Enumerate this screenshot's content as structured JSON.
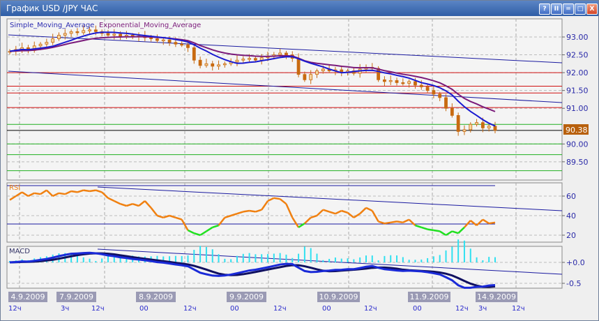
{
  "window": {
    "title": "График USD /JPY  ЧАС",
    "buttons": [
      "?",
      "II",
      "=",
      "□",
      "X"
    ]
  },
  "price_panel": {
    "legend_sma": "Simple_Moving_Average",
    "legend_ema": "Exponential_Moving_Average",
    "axis_labels": [
      "93.00",
      "92.50",
      "92.00",
      "91.50",
      "91.00",
      "90.00",
      "89.50"
    ],
    "axis_values": [
      93.0,
      92.5,
      92.0,
      91.5,
      91.0,
      90.0,
      89.5
    ],
    "current_price": "90.38",
    "current_value": 90.38,
    "red_levels": [
      92.0,
      91.62,
      91.43,
      91.02
    ],
    "green_levels": [
      90.55,
      90.0,
      89.7,
      89.25
    ],
    "closes": [
      92.6,
      92.65,
      92.7,
      92.62,
      92.75,
      92.8,
      92.85,
      92.95,
      93.05,
      93.1,
      93.15,
      93.12,
      93.18,
      93.2,
      93.15,
      93.1,
      93.05,
      93.08,
      93.02,
      93.05,
      93.0,
      93.03,
      92.98,
      92.95,
      92.9,
      92.92,
      92.85,
      92.8,
      92.78,
      92.7,
      92.35,
      92.2,
      92.25,
      92.18,
      92.22,
      92.25,
      92.3,
      92.35,
      92.38,
      92.4,
      92.35,
      92.42,
      92.45,
      92.5,
      92.55,
      92.5,
      92.4,
      91.95,
      91.8,
      91.95,
      92.05,
      92.1,
      92.05,
      92.08,
      92.0,
      92.05,
      91.98,
      92.1,
      92.15,
      92.12,
      91.8,
      91.75,
      91.78,
      91.72,
      91.7,
      91.75,
      91.65,
      91.6,
      91.5,
      91.4,
      91.3,
      91.0,
      90.8,
      90.35,
      90.4,
      90.55,
      90.6,
      90.45,
      90.5,
      90.38
    ],
    "colors": {
      "candle": "#c86a10",
      "sma": "#1a1ad0",
      "ema": "#7a1a7a",
      "red": "#d01010",
      "green": "#20b020",
      "trend": "#1a1aa0"
    }
  },
  "rsi_panel": {
    "label": "RSI",
    "axis_labels": [
      "60",
      "40",
      "20"
    ],
    "axis_values": [
      60,
      40,
      20
    ],
    "level": 31,
    "values": [
      56,
      60,
      64,
      60,
      63,
      62,
      66,
      60,
      63,
      62,
      65,
      64,
      66,
      65,
      66,
      64,
      58,
      55,
      52,
      50,
      52,
      50,
      55,
      48,
      40,
      38,
      40,
      38,
      36,
      25,
      22,
      20,
      24,
      28,
      30,
      38,
      40,
      42,
      44,
      45,
      44,
      46,
      55,
      58,
      57,
      52,
      38,
      28,
      32,
      38,
      40,
      46,
      44,
      42,
      45,
      43,
      38,
      42,
      48,
      45,
      34,
      32,
      33,
      34,
      33,
      36,
      30,
      28,
      26,
      25,
      24,
      20,
      24,
      22,
      28,
      35,
      30,
      36,
      32,
      33
    ],
    "colors": {
      "line": "#f08010",
      "low": "#20e020"
    }
  },
  "macd_panel": {
    "label": "MACD",
    "axis_labels": [
      "+0.0",
      "-0.5"
    ],
    "axis_values": [
      0,
      -0.5
    ]
  },
  "x_axis": {
    "dates": [
      "4.9.2009",
      "7.9.2009",
      "8.9.2009",
      "9.9.2009",
      "10.9.2009",
      "11.9.2009",
      "14.9.2009"
    ],
    "hours": [
      "12ч",
      "3ч",
      "12ч",
      "00",
      "12ч",
      "00",
      "12ч",
      "00",
      "12ч",
      "00",
      "12ч",
      "3ч",
      "12ч"
    ]
  }
}
